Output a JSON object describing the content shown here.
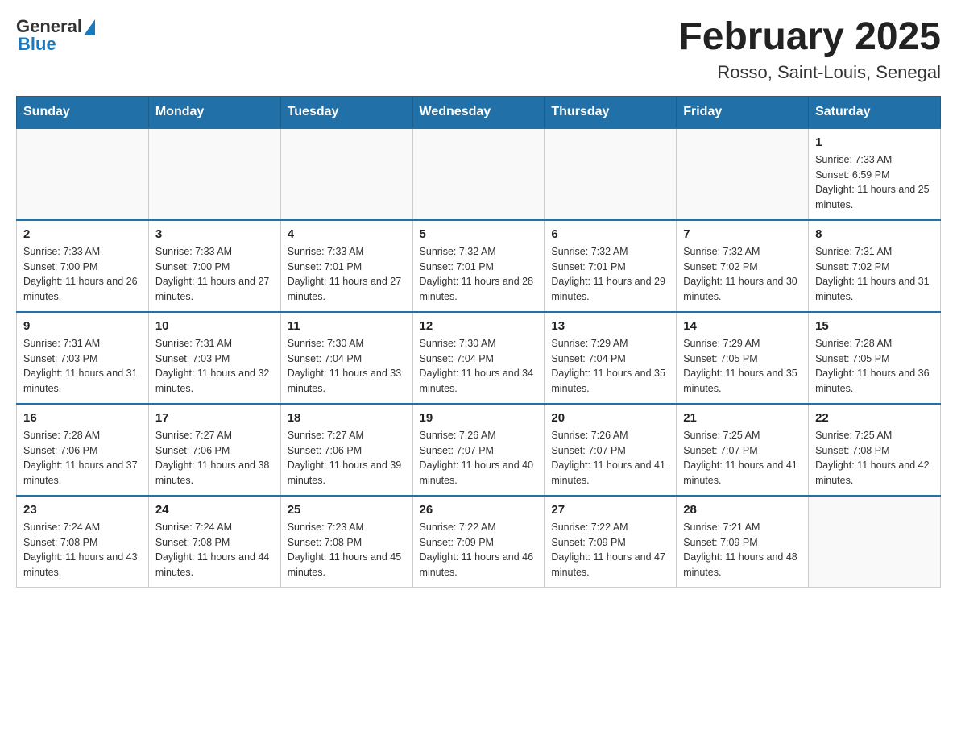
{
  "header": {
    "logo_general": "General",
    "logo_blue": "Blue",
    "month_title": "February 2025",
    "location": "Rosso, Saint-Louis, Senegal"
  },
  "weekdays": [
    "Sunday",
    "Monday",
    "Tuesday",
    "Wednesday",
    "Thursday",
    "Friday",
    "Saturday"
  ],
  "weeks": [
    [
      {
        "day": "",
        "sunrise": "",
        "sunset": "",
        "daylight": ""
      },
      {
        "day": "",
        "sunrise": "",
        "sunset": "",
        "daylight": ""
      },
      {
        "day": "",
        "sunrise": "",
        "sunset": "",
        "daylight": ""
      },
      {
        "day": "",
        "sunrise": "",
        "sunset": "",
        "daylight": ""
      },
      {
        "day": "",
        "sunrise": "",
        "sunset": "",
        "daylight": ""
      },
      {
        "day": "",
        "sunrise": "",
        "sunset": "",
        "daylight": ""
      },
      {
        "day": "1",
        "sunrise": "Sunrise: 7:33 AM",
        "sunset": "Sunset: 6:59 PM",
        "daylight": "Daylight: 11 hours and 25 minutes."
      }
    ],
    [
      {
        "day": "2",
        "sunrise": "Sunrise: 7:33 AM",
        "sunset": "Sunset: 7:00 PM",
        "daylight": "Daylight: 11 hours and 26 minutes."
      },
      {
        "day": "3",
        "sunrise": "Sunrise: 7:33 AM",
        "sunset": "Sunset: 7:00 PM",
        "daylight": "Daylight: 11 hours and 27 minutes."
      },
      {
        "day": "4",
        "sunrise": "Sunrise: 7:33 AM",
        "sunset": "Sunset: 7:01 PM",
        "daylight": "Daylight: 11 hours and 27 minutes."
      },
      {
        "day": "5",
        "sunrise": "Sunrise: 7:32 AM",
        "sunset": "Sunset: 7:01 PM",
        "daylight": "Daylight: 11 hours and 28 minutes."
      },
      {
        "day": "6",
        "sunrise": "Sunrise: 7:32 AM",
        "sunset": "Sunset: 7:01 PM",
        "daylight": "Daylight: 11 hours and 29 minutes."
      },
      {
        "day": "7",
        "sunrise": "Sunrise: 7:32 AM",
        "sunset": "Sunset: 7:02 PM",
        "daylight": "Daylight: 11 hours and 30 minutes."
      },
      {
        "day": "8",
        "sunrise": "Sunrise: 7:31 AM",
        "sunset": "Sunset: 7:02 PM",
        "daylight": "Daylight: 11 hours and 31 minutes."
      }
    ],
    [
      {
        "day": "9",
        "sunrise": "Sunrise: 7:31 AM",
        "sunset": "Sunset: 7:03 PM",
        "daylight": "Daylight: 11 hours and 31 minutes."
      },
      {
        "day": "10",
        "sunrise": "Sunrise: 7:31 AM",
        "sunset": "Sunset: 7:03 PM",
        "daylight": "Daylight: 11 hours and 32 minutes."
      },
      {
        "day": "11",
        "sunrise": "Sunrise: 7:30 AM",
        "sunset": "Sunset: 7:04 PM",
        "daylight": "Daylight: 11 hours and 33 minutes."
      },
      {
        "day": "12",
        "sunrise": "Sunrise: 7:30 AM",
        "sunset": "Sunset: 7:04 PM",
        "daylight": "Daylight: 11 hours and 34 minutes."
      },
      {
        "day": "13",
        "sunrise": "Sunrise: 7:29 AM",
        "sunset": "Sunset: 7:04 PM",
        "daylight": "Daylight: 11 hours and 35 minutes."
      },
      {
        "day": "14",
        "sunrise": "Sunrise: 7:29 AM",
        "sunset": "Sunset: 7:05 PM",
        "daylight": "Daylight: 11 hours and 35 minutes."
      },
      {
        "day": "15",
        "sunrise": "Sunrise: 7:28 AM",
        "sunset": "Sunset: 7:05 PM",
        "daylight": "Daylight: 11 hours and 36 minutes."
      }
    ],
    [
      {
        "day": "16",
        "sunrise": "Sunrise: 7:28 AM",
        "sunset": "Sunset: 7:06 PM",
        "daylight": "Daylight: 11 hours and 37 minutes."
      },
      {
        "day": "17",
        "sunrise": "Sunrise: 7:27 AM",
        "sunset": "Sunset: 7:06 PM",
        "daylight": "Daylight: 11 hours and 38 minutes."
      },
      {
        "day": "18",
        "sunrise": "Sunrise: 7:27 AM",
        "sunset": "Sunset: 7:06 PM",
        "daylight": "Daylight: 11 hours and 39 minutes."
      },
      {
        "day": "19",
        "sunrise": "Sunrise: 7:26 AM",
        "sunset": "Sunset: 7:07 PM",
        "daylight": "Daylight: 11 hours and 40 minutes."
      },
      {
        "day": "20",
        "sunrise": "Sunrise: 7:26 AM",
        "sunset": "Sunset: 7:07 PM",
        "daylight": "Daylight: 11 hours and 41 minutes."
      },
      {
        "day": "21",
        "sunrise": "Sunrise: 7:25 AM",
        "sunset": "Sunset: 7:07 PM",
        "daylight": "Daylight: 11 hours and 41 minutes."
      },
      {
        "day": "22",
        "sunrise": "Sunrise: 7:25 AM",
        "sunset": "Sunset: 7:08 PM",
        "daylight": "Daylight: 11 hours and 42 minutes."
      }
    ],
    [
      {
        "day": "23",
        "sunrise": "Sunrise: 7:24 AM",
        "sunset": "Sunset: 7:08 PM",
        "daylight": "Daylight: 11 hours and 43 minutes."
      },
      {
        "day": "24",
        "sunrise": "Sunrise: 7:24 AM",
        "sunset": "Sunset: 7:08 PM",
        "daylight": "Daylight: 11 hours and 44 minutes."
      },
      {
        "day": "25",
        "sunrise": "Sunrise: 7:23 AM",
        "sunset": "Sunset: 7:08 PM",
        "daylight": "Daylight: 11 hours and 45 minutes."
      },
      {
        "day": "26",
        "sunrise": "Sunrise: 7:22 AM",
        "sunset": "Sunset: 7:09 PM",
        "daylight": "Daylight: 11 hours and 46 minutes."
      },
      {
        "day": "27",
        "sunrise": "Sunrise: 7:22 AM",
        "sunset": "Sunset: 7:09 PM",
        "daylight": "Daylight: 11 hours and 47 minutes."
      },
      {
        "day": "28",
        "sunrise": "Sunrise: 7:21 AM",
        "sunset": "Sunset: 7:09 PM",
        "daylight": "Daylight: 11 hours and 48 minutes."
      },
      {
        "day": "",
        "sunrise": "",
        "sunset": "",
        "daylight": ""
      }
    ]
  ]
}
